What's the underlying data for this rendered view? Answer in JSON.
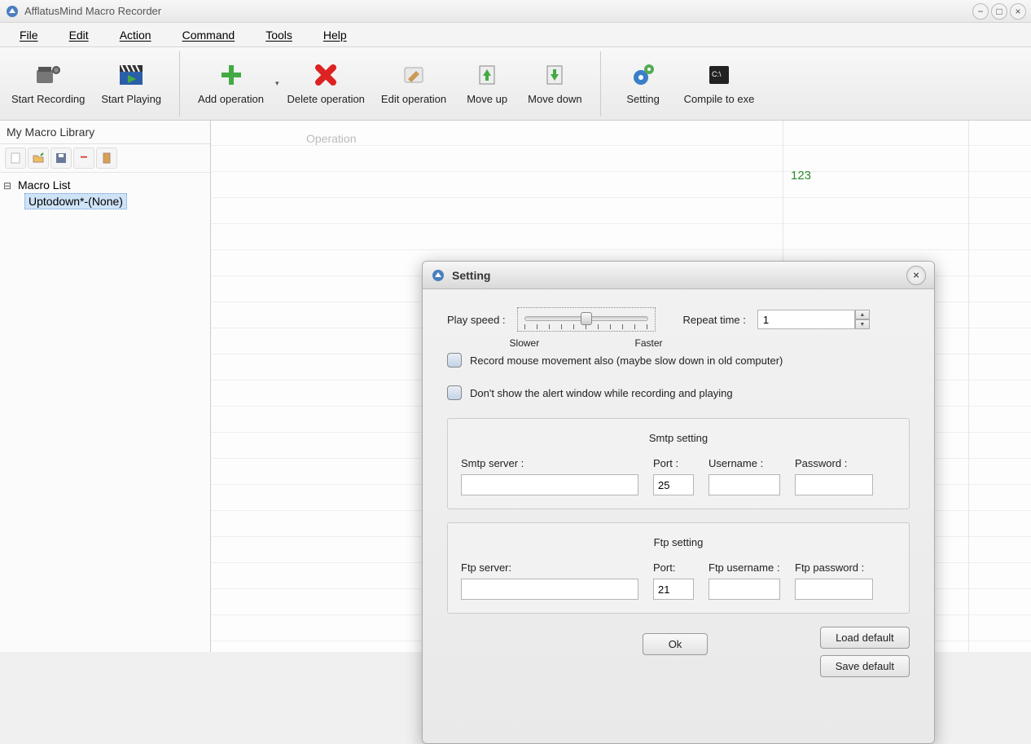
{
  "window": {
    "title": "AfflatusMind Macro Recorder"
  },
  "menubar": [
    "File",
    "Edit",
    "Action",
    "Command",
    "Tools",
    "Help"
  ],
  "toolbar": {
    "start_recording": "Start Recording",
    "start_playing": "Start Playing",
    "add_operation": "Add operation",
    "delete_operation": "Delete operation",
    "edit_operation": "Edit operation",
    "move_up": "Move up",
    "move_down": "Move down",
    "setting": "Setting",
    "compile": "Compile to exe"
  },
  "sidebar": {
    "header": "My Macro Library",
    "root": "Macro List",
    "child": "Uptodown*-(None)"
  },
  "main": {
    "operation_tab": "Operation",
    "cell_value": "123"
  },
  "dialog": {
    "title": "Setting",
    "play_speed_label": "Play speed :",
    "slower": "Slower",
    "faster": "Faster",
    "repeat_time_label": "Repeat time :",
    "repeat_time_value": "1",
    "check1": "Record mouse movement also (maybe slow down in old computer)",
    "check2": "Don't show the alert window while recording and playing",
    "smtp": {
      "title": "Smtp setting",
      "server_label": "Smtp server :",
      "server_value": "",
      "port_label": "Port :",
      "port_value": "25",
      "user_label": "Username :",
      "user_value": "",
      "pass_label": "Password :",
      "pass_value": ""
    },
    "ftp": {
      "title": "Ftp setting",
      "server_label": "Ftp server:",
      "server_value": "",
      "port_label": "Port:",
      "port_value": "21",
      "user_label": "Ftp username :",
      "user_value": "",
      "pass_label": "Ftp password :",
      "pass_value": ""
    },
    "buttons": {
      "ok": "Ok",
      "load_default": "Load default",
      "save_default": "Save default"
    }
  }
}
